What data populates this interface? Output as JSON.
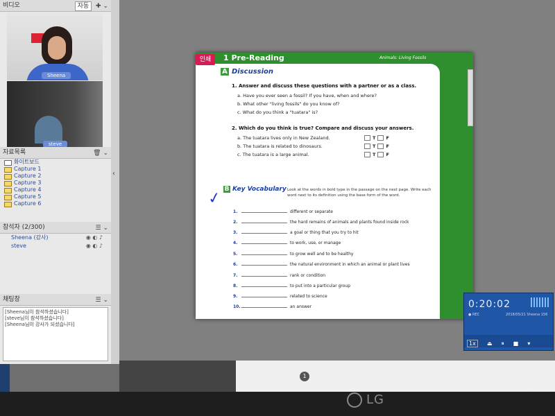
{
  "video_panel": {
    "title": "비디오",
    "mode_label": "자동",
    "participants": [
      {
        "name": "Sheena"
      },
      {
        "name": "steve"
      }
    ]
  },
  "capture_panel": {
    "title": "자료목록",
    "items": [
      "화이트보드",
      "Capture 1",
      "Capture 2",
      "Capture 3",
      "Capture 4",
      "Capture 5",
      "Capture 6"
    ]
  },
  "people_panel": {
    "title": "참석자 (2/300)",
    "people": [
      {
        "name": "Sheena (강사)"
      },
      {
        "name": "steve"
      }
    ]
  },
  "chat_panel": {
    "title": "채팅창",
    "messages": [
      "[Sheena님이 참석하셨습니다]",
      "[steve님이 참석하셨습니다]",
      "[Sheena님이 강사가 되셨습니다]"
    ]
  },
  "document": {
    "print_label": "인쇄",
    "unit_title": "1  Pre-Reading",
    "unit_subtitle": "Animals: Living Fossils",
    "section_a": {
      "badge": "A",
      "title": "Discussion"
    },
    "q1": "1. Answer and discuss these questions with a partner or as a class.",
    "q1_options": [
      "a. Have you ever seen a fossil? If you have, when and where?",
      "b. What other \"living fossils\" do you know of?",
      "c. What do you think a \"tuatara\" is?"
    ],
    "q2": "2. Which do you think is true? Compare and discuss your answers.",
    "q2_options": [
      "a. The tuatara lives only in New Zealand.",
      "b. The tuatara is related to dinosaurs.",
      "c. The tuatara is a large animal."
    ],
    "tf_labels": [
      "T",
      "F"
    ],
    "section_b": {
      "badge": "B",
      "title": "Key Vocabulary"
    },
    "section_b_instructions": "Look at the words in bold type in the passage on the next page. Write each word next to its definition using the base form of the word.",
    "vocab": [
      {
        "num": "1.",
        "def": "different or separate"
      },
      {
        "num": "2.",
        "def": "the hard remains of animals and plants found inside rock"
      },
      {
        "num": "3.",
        "def": "a goal or thing that you try to hit"
      },
      {
        "num": "4.",
        "def": "to work, use, or manage"
      },
      {
        "num": "5.",
        "def": "to grow well and to be healthy"
      },
      {
        "num": "6.",
        "def": "the natural environment in which an animal or plant lives"
      },
      {
        "num": "7.",
        "def": "rank or condition"
      },
      {
        "num": "8.",
        "def": "to put into a particular group"
      },
      {
        "num": "9.",
        "def": "related to science"
      },
      {
        "num": "10.",
        "def": "an answer"
      }
    ]
  },
  "page_number": "1",
  "timer": {
    "time": "0:20:02",
    "date": "2018/05/21 Sheena 156",
    "speed": "1x"
  },
  "monitor_brand": "LG"
}
